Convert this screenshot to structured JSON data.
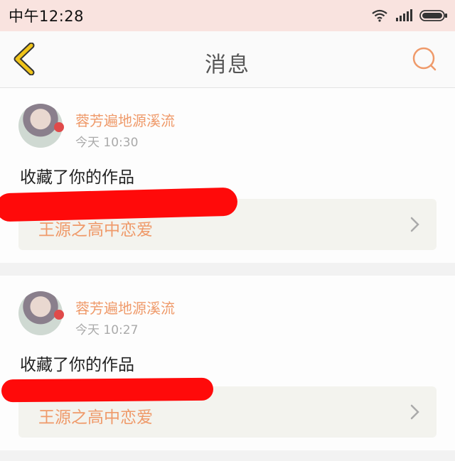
{
  "status_bar": {
    "time": "中午12:28",
    "icons": [
      "wifi-icon",
      "signal-icon",
      "battery-icon"
    ]
  },
  "header": {
    "title": "消息",
    "back_icon": "chevron-left-icon",
    "search_icon": "search-icon"
  },
  "colors": {
    "accent": "#ef9a6a",
    "back_icon": "#f0c419",
    "redaction": "#ff0a0a"
  },
  "messages": [
    {
      "username": "蓉芳遍地源溪流",
      "time": "今天 10:30",
      "action": "收藏了你的作品",
      "work_title": "王源之高中恋爱"
    },
    {
      "username": "蓉芳遍地源溪流",
      "time": "今天 10:27",
      "action": "收藏了你的作品",
      "work_title": "王源之高中恋爱"
    }
  ]
}
